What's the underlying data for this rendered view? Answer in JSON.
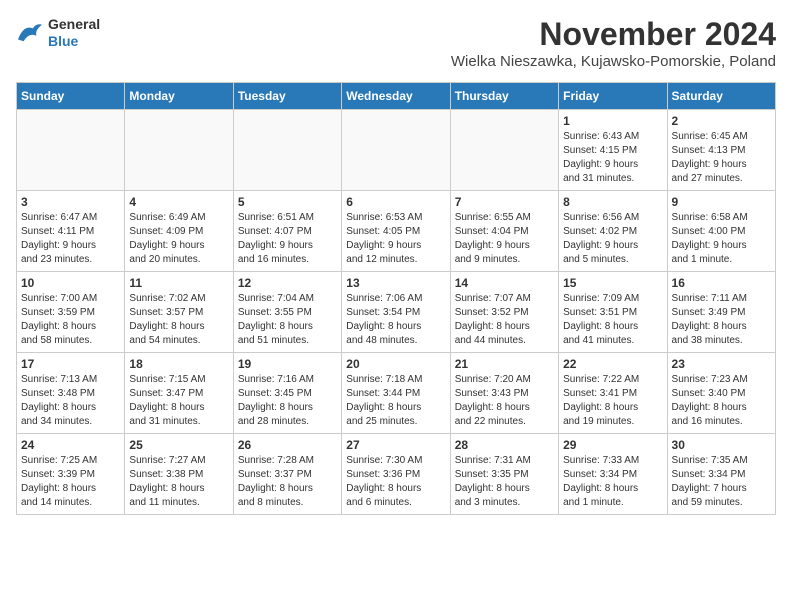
{
  "logo": {
    "line1": "General",
    "line2": "Blue"
  },
  "title": "November 2024",
  "location": "Wielka Nieszawka, Kujawsko-Pomorskie, Poland",
  "weekdays": [
    "Sunday",
    "Monday",
    "Tuesday",
    "Wednesday",
    "Thursday",
    "Friday",
    "Saturday"
  ],
  "weeks": [
    [
      {
        "day": "",
        "info": ""
      },
      {
        "day": "",
        "info": ""
      },
      {
        "day": "",
        "info": ""
      },
      {
        "day": "",
        "info": ""
      },
      {
        "day": "",
        "info": ""
      },
      {
        "day": "1",
        "info": "Sunrise: 6:43 AM\nSunset: 4:15 PM\nDaylight: 9 hours\nand 31 minutes."
      },
      {
        "day": "2",
        "info": "Sunrise: 6:45 AM\nSunset: 4:13 PM\nDaylight: 9 hours\nand 27 minutes."
      }
    ],
    [
      {
        "day": "3",
        "info": "Sunrise: 6:47 AM\nSunset: 4:11 PM\nDaylight: 9 hours\nand 23 minutes."
      },
      {
        "day": "4",
        "info": "Sunrise: 6:49 AM\nSunset: 4:09 PM\nDaylight: 9 hours\nand 20 minutes."
      },
      {
        "day": "5",
        "info": "Sunrise: 6:51 AM\nSunset: 4:07 PM\nDaylight: 9 hours\nand 16 minutes."
      },
      {
        "day": "6",
        "info": "Sunrise: 6:53 AM\nSunset: 4:05 PM\nDaylight: 9 hours\nand 12 minutes."
      },
      {
        "day": "7",
        "info": "Sunrise: 6:55 AM\nSunset: 4:04 PM\nDaylight: 9 hours\nand 9 minutes."
      },
      {
        "day": "8",
        "info": "Sunrise: 6:56 AM\nSunset: 4:02 PM\nDaylight: 9 hours\nand 5 minutes."
      },
      {
        "day": "9",
        "info": "Sunrise: 6:58 AM\nSunset: 4:00 PM\nDaylight: 9 hours\nand 1 minute."
      }
    ],
    [
      {
        "day": "10",
        "info": "Sunrise: 7:00 AM\nSunset: 3:59 PM\nDaylight: 8 hours\nand 58 minutes."
      },
      {
        "day": "11",
        "info": "Sunrise: 7:02 AM\nSunset: 3:57 PM\nDaylight: 8 hours\nand 54 minutes."
      },
      {
        "day": "12",
        "info": "Sunrise: 7:04 AM\nSunset: 3:55 PM\nDaylight: 8 hours\nand 51 minutes."
      },
      {
        "day": "13",
        "info": "Sunrise: 7:06 AM\nSunset: 3:54 PM\nDaylight: 8 hours\nand 48 minutes."
      },
      {
        "day": "14",
        "info": "Sunrise: 7:07 AM\nSunset: 3:52 PM\nDaylight: 8 hours\nand 44 minutes."
      },
      {
        "day": "15",
        "info": "Sunrise: 7:09 AM\nSunset: 3:51 PM\nDaylight: 8 hours\nand 41 minutes."
      },
      {
        "day": "16",
        "info": "Sunrise: 7:11 AM\nSunset: 3:49 PM\nDaylight: 8 hours\nand 38 minutes."
      }
    ],
    [
      {
        "day": "17",
        "info": "Sunrise: 7:13 AM\nSunset: 3:48 PM\nDaylight: 8 hours\nand 34 minutes."
      },
      {
        "day": "18",
        "info": "Sunrise: 7:15 AM\nSunset: 3:47 PM\nDaylight: 8 hours\nand 31 minutes."
      },
      {
        "day": "19",
        "info": "Sunrise: 7:16 AM\nSunset: 3:45 PM\nDaylight: 8 hours\nand 28 minutes."
      },
      {
        "day": "20",
        "info": "Sunrise: 7:18 AM\nSunset: 3:44 PM\nDaylight: 8 hours\nand 25 minutes."
      },
      {
        "day": "21",
        "info": "Sunrise: 7:20 AM\nSunset: 3:43 PM\nDaylight: 8 hours\nand 22 minutes."
      },
      {
        "day": "22",
        "info": "Sunrise: 7:22 AM\nSunset: 3:41 PM\nDaylight: 8 hours\nand 19 minutes."
      },
      {
        "day": "23",
        "info": "Sunrise: 7:23 AM\nSunset: 3:40 PM\nDaylight: 8 hours\nand 16 minutes."
      }
    ],
    [
      {
        "day": "24",
        "info": "Sunrise: 7:25 AM\nSunset: 3:39 PM\nDaylight: 8 hours\nand 14 minutes."
      },
      {
        "day": "25",
        "info": "Sunrise: 7:27 AM\nSunset: 3:38 PM\nDaylight: 8 hours\nand 11 minutes."
      },
      {
        "day": "26",
        "info": "Sunrise: 7:28 AM\nSunset: 3:37 PM\nDaylight: 8 hours\nand 8 minutes."
      },
      {
        "day": "27",
        "info": "Sunrise: 7:30 AM\nSunset: 3:36 PM\nDaylight: 8 hours\nand 6 minutes."
      },
      {
        "day": "28",
        "info": "Sunrise: 7:31 AM\nSunset: 3:35 PM\nDaylight: 8 hours\nand 3 minutes."
      },
      {
        "day": "29",
        "info": "Sunrise: 7:33 AM\nSunset: 3:34 PM\nDaylight: 8 hours\nand 1 minute."
      },
      {
        "day": "30",
        "info": "Sunrise: 7:35 AM\nSunset: 3:34 PM\nDaylight: 7 hours\nand 59 minutes."
      }
    ]
  ]
}
